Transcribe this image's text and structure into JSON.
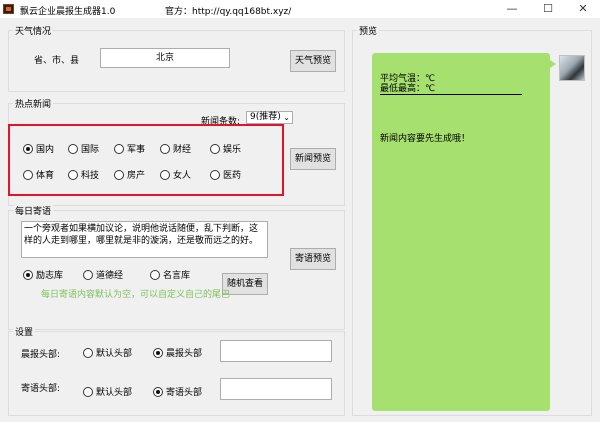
{
  "window": {
    "title": "飘云企业晨报生成器1.0",
    "url": "官方：http://qy.qq168bt.xyz/",
    "minimize": "—",
    "maximize": "☐",
    "close": "✕"
  },
  "weather": {
    "legend": "天气情况",
    "label": "省、市、县",
    "value": "北京",
    "preview_button": "天气预览"
  },
  "news": {
    "legend": "热点新闻",
    "count_label": "新闻条数:",
    "count_value": "9(推荐)",
    "categories": [
      {
        "label": "国内",
        "checked": true
      },
      {
        "label": "国际",
        "checked": false
      },
      {
        "label": "军事",
        "checked": false
      },
      {
        "label": "财经",
        "checked": false
      },
      {
        "label": "娱乐",
        "checked": false
      },
      {
        "label": "体育",
        "checked": false
      },
      {
        "label": "科技",
        "checked": false
      },
      {
        "label": "房产",
        "checked": false
      },
      {
        "label": "女人",
        "checked": false
      },
      {
        "label": "医药",
        "checked": false
      }
    ],
    "preview_button": "新闻预览"
  },
  "daily": {
    "legend": "每日寄语",
    "text": "一个旁观者如果横加议论，说明他说话随便，乱下判断，这样的人走到哪里，哪里就是非的漩涡，还是敬而远之的好。",
    "sources": [
      {
        "label": "励志库",
        "checked": true
      },
      {
        "label": "道德经",
        "checked": false
      },
      {
        "label": "名言库",
        "checked": false
      }
    ],
    "random_button": "随机查看",
    "preview_button": "寄语预览",
    "hint": "每日寄语内容默认为空，可以自定义自己的尾巴"
  },
  "settings": {
    "legend": "设置",
    "morning_label": "晨报头部:",
    "morning_options": [
      {
        "label": "默认头部",
        "checked": false
      },
      {
        "label": "晨报头部",
        "checked": true
      }
    ],
    "morning_value": "",
    "quote_label": "寄语头部:",
    "quote_options": [
      {
        "label": "默认头部",
        "checked": false
      },
      {
        "label": "寄语头部",
        "checked": true
      }
    ],
    "quote_value": ""
  },
  "preview": {
    "legend": "预览",
    "avg_temp": "平均气温：℃",
    "min_max": "最低最高：℃",
    "news_msg": "新闻内容要先生成哦！"
  }
}
